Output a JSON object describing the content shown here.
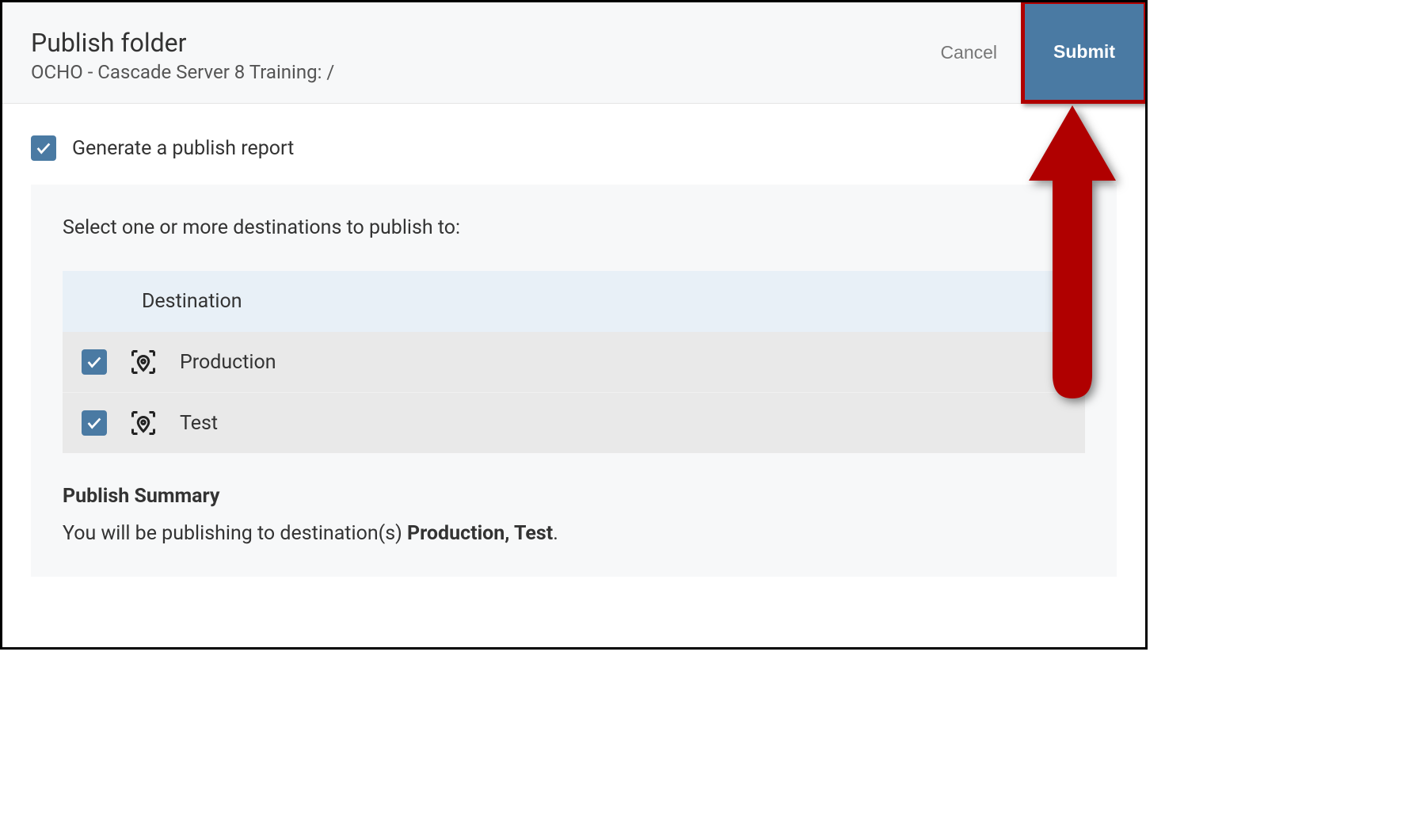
{
  "header": {
    "title": "Publish folder",
    "subtitle": "OCHO - Cascade Server 8 Training: /",
    "cancel_label": "Cancel",
    "submit_label": "Submit"
  },
  "report": {
    "label": "Generate a publish report",
    "checked": true
  },
  "destinations": {
    "prompt": "Select one or more destinations to publish to:",
    "column_header": "Destination",
    "items": [
      {
        "label": "Production",
        "checked": true
      },
      {
        "label": "Test",
        "checked": true
      }
    ]
  },
  "summary": {
    "title": "Publish Summary",
    "text_prefix": "You will be publishing to destination(s) ",
    "text_bold": "Production, Test",
    "text_suffix": "."
  }
}
